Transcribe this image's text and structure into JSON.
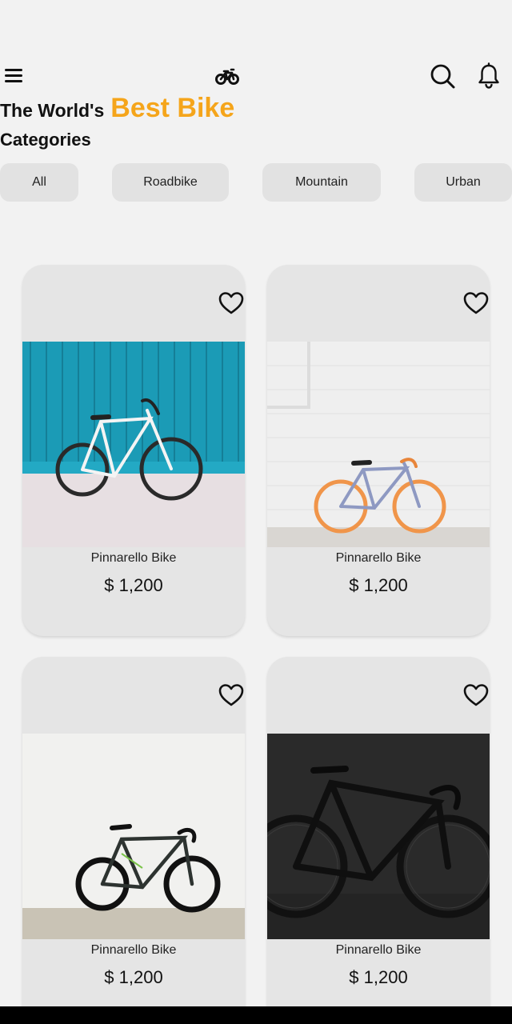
{
  "header": {
    "menu_icon": "hamburger-menu-icon",
    "logo_icon": "bicycle-logo-icon",
    "search_icon": "search-icon",
    "notification_icon": "bell-icon",
    "title_prefix": "The World's",
    "title_accent": "Best Bike",
    "accent_color": "#f5a51b"
  },
  "categories": {
    "title": "Categories",
    "items": [
      "All",
      "Roadbike",
      "Mountain",
      "Urban"
    ]
  },
  "products": [
    {
      "name": "Pinnarello Bike",
      "price": "$ 1,200",
      "image": "white-bike-blue-wall-photo",
      "favorite_icon": "heart-outline-icon"
    },
    {
      "name": "Pinnarello Bike",
      "price": "$ 1,200",
      "image": "orange-wheel-bike-white-wall-photo",
      "favorite_icon": "heart-outline-icon"
    },
    {
      "name": "Pinnarello Bike",
      "price": "$ 1,200",
      "image": "black-fixie-bike-white-wall-photo",
      "favorite_icon": "heart-outline-icon"
    },
    {
      "name": "Pinnarello Bike",
      "price": "$ 1,200",
      "image": "black-road-bike-dark-photo",
      "favorite_icon": "heart-outline-icon"
    }
  ],
  "colors": {
    "background": "#f2f2f2",
    "card": "#e5e5e5",
    "chip": "#e2e2e2"
  }
}
